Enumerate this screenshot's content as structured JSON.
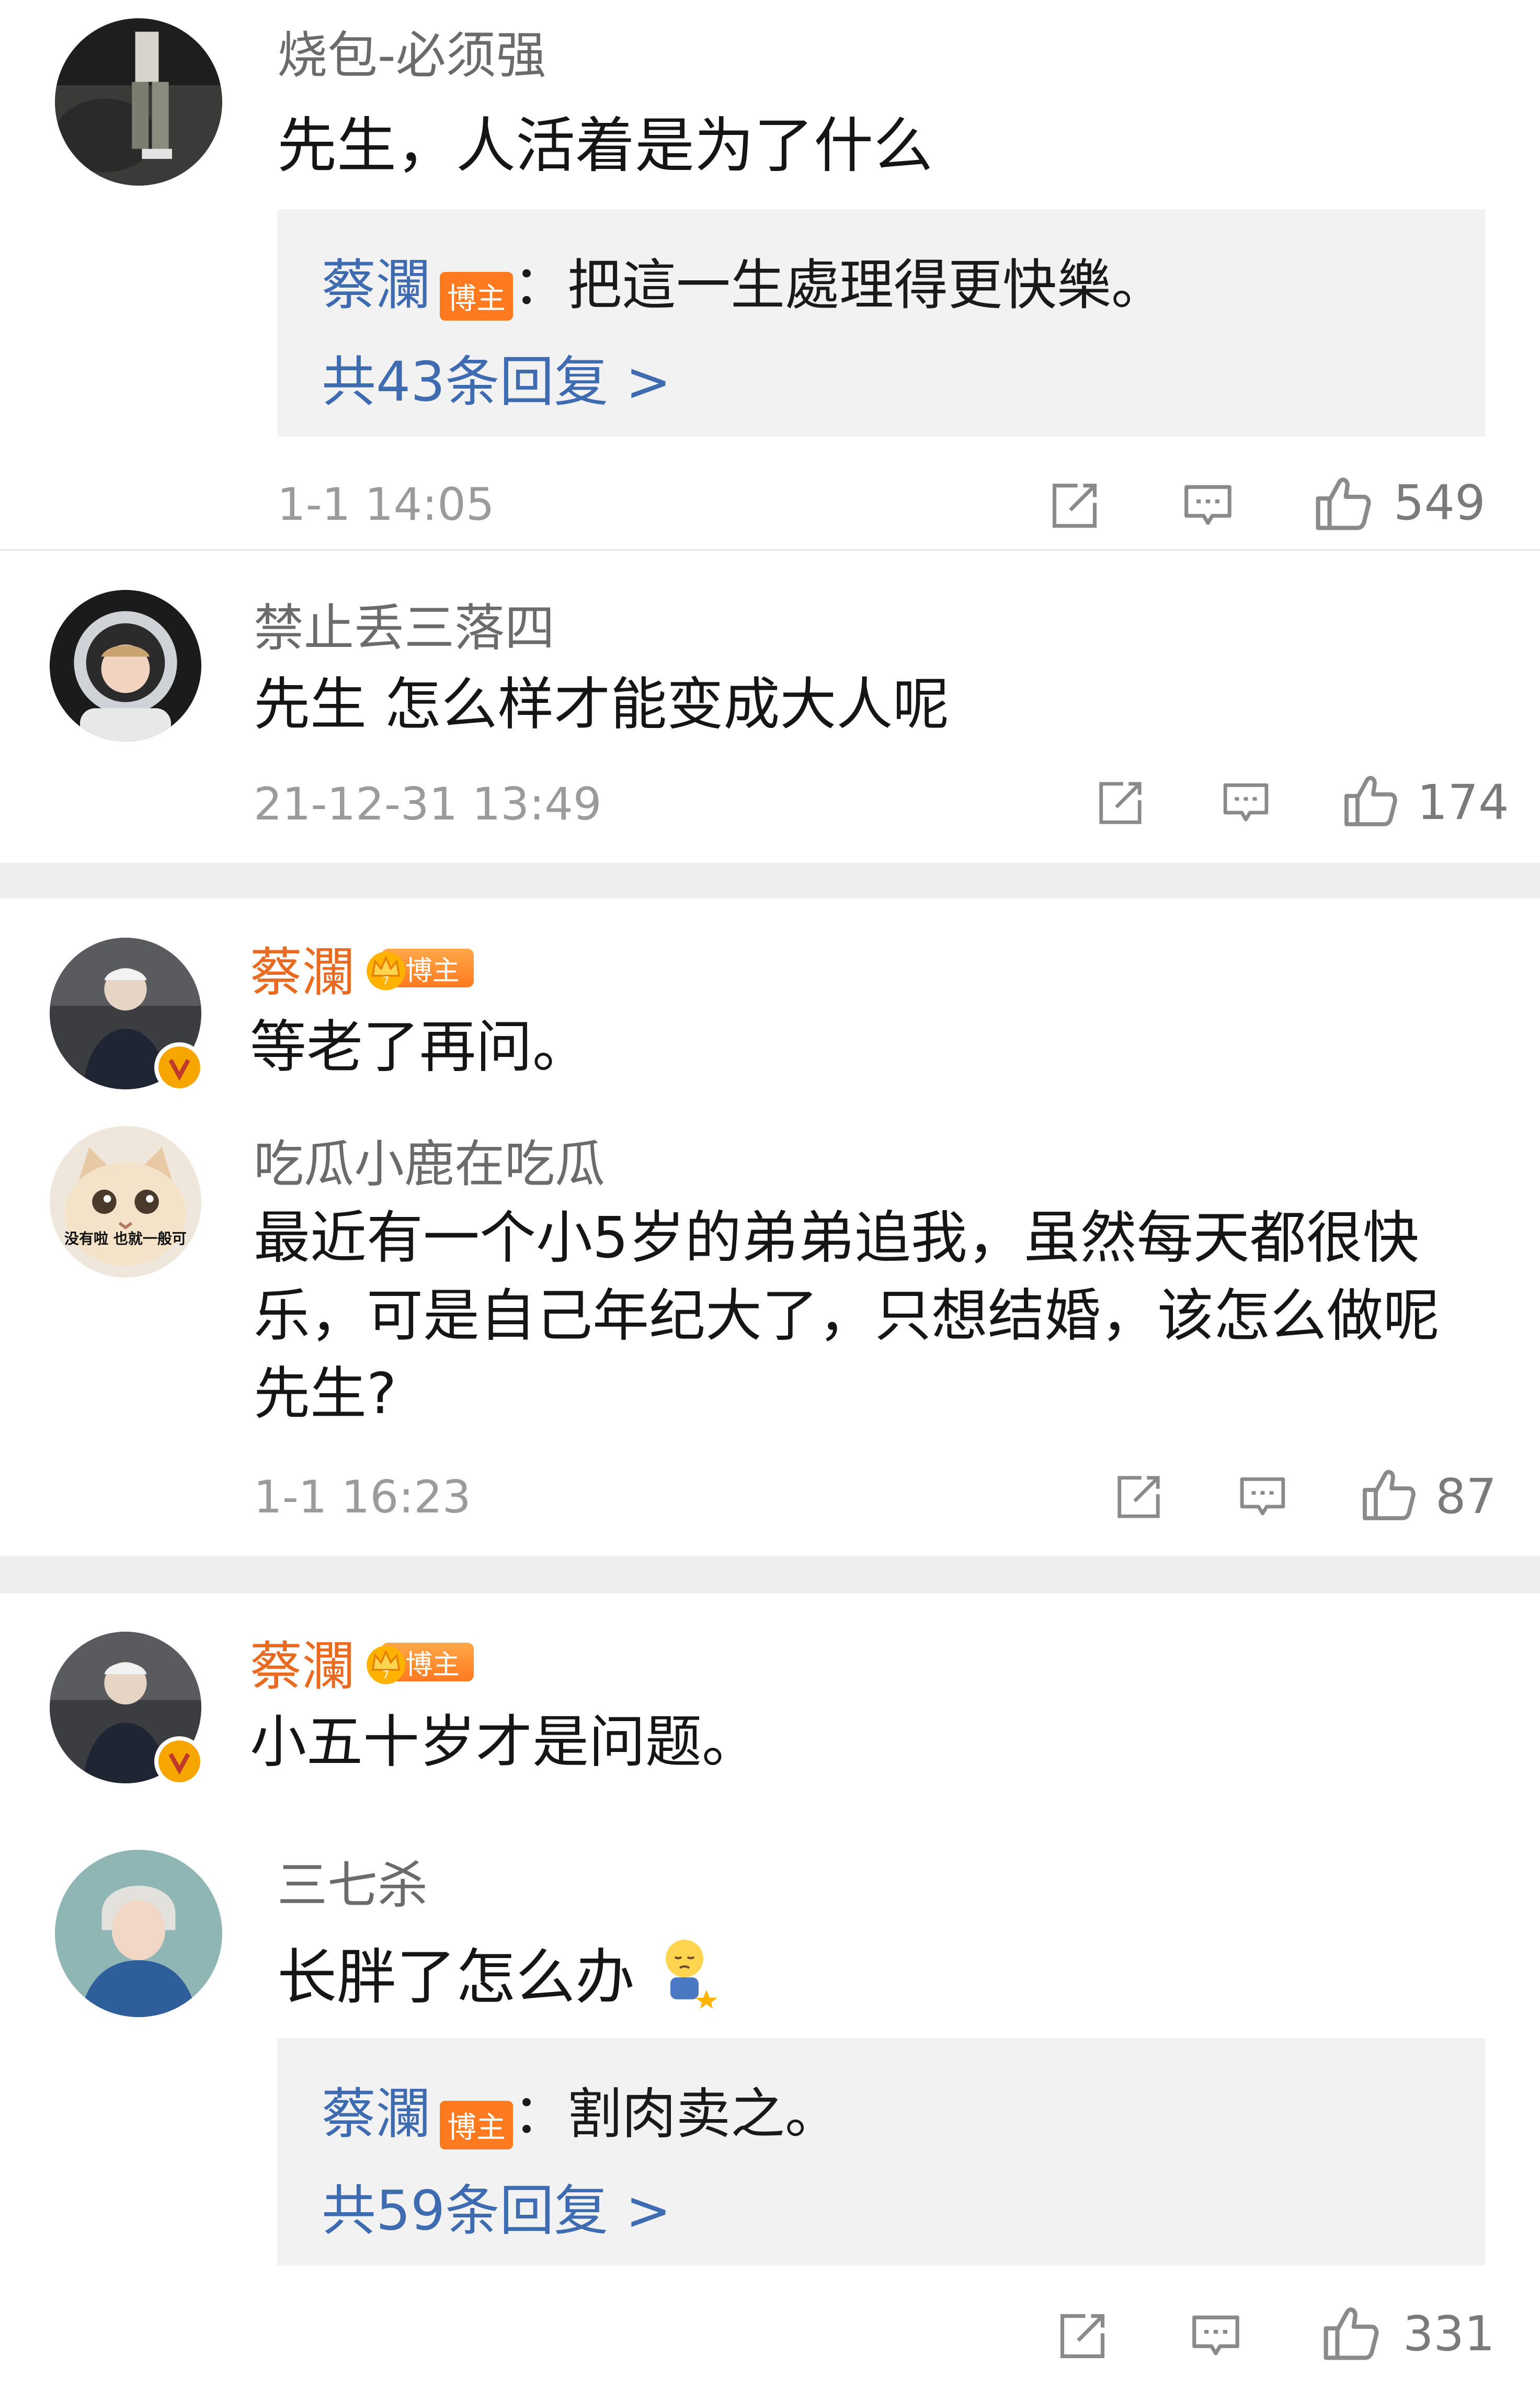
{
  "comments": [
    {
      "username": "烧包-必须强",
      "text": "先生，人活着是为了什么",
      "reply": {
        "author": "蔡瀾",
        "badge": "博主",
        "text": "：把這一生處理得更快樂。",
        "more": "共43条回复 >"
      },
      "time": "1-1 14:05",
      "likes": "549",
      "avatar": "avatar-photo-walking"
    },
    {
      "username": "禁止丢三落四",
      "text": "先生 怎么样才能变成大人呢",
      "time": "21-12-31 13:49",
      "likes": "174",
      "avatar": "avatar-astronaut"
    },
    {
      "username": "蔡瀾",
      "badge": "博主",
      "text": "等老了再问。",
      "avatar": "avatar-host",
      "verified": true
    },
    {
      "username": "吃瓜小鹿在吃瓜",
      "text": "最近有一个小5岁的弟弟追我，虽然每天都很快乐，可是自己年纪大了，只想结婚，该怎么做呢先生?",
      "avatar_caption": "没有啦 也就一般可",
      "time": "1-1 16:23",
      "likes": "87",
      "avatar": "avatar-cat"
    },
    {
      "username": "蔡瀾",
      "badge": "博主",
      "text": "小五十岁才是问题。",
      "avatar": "avatar-host",
      "verified": true
    },
    {
      "username": "三七杀",
      "text": "长胖了怎么办",
      "emoji": "sad-emoji",
      "reply": {
        "author": "蔡瀾",
        "badge": "博主",
        "text": "：割肉卖之。",
        "more": "共59条回复 >"
      },
      "likes": "331",
      "avatar": "avatar-portrait"
    }
  ],
  "colors": {
    "host_name": "#e96b22",
    "link_blue": "#3f6cb0",
    "reply_bg": "#f2f2f2",
    "separator": "#eeeeee",
    "badge_orange": "#ff7a1e"
  },
  "icons": [
    "share-icon",
    "comment-icon",
    "like-icon",
    "crown-icon",
    "verified-icon"
  ]
}
